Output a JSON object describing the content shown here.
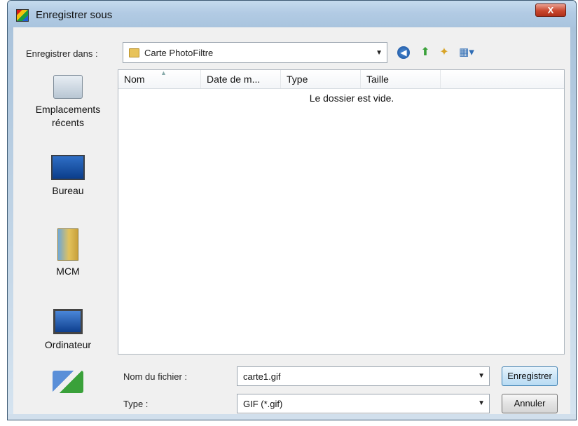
{
  "window": {
    "title": "Enregistrer sous",
    "close_glyph": "X"
  },
  "toolbar": {
    "save_in_label": "Enregistrer dans :",
    "save_in_value": "Carte PhotoFiltre",
    "icons": [
      "back-icon",
      "up-folder-icon",
      "new-folder-icon",
      "views-menu-icon"
    ]
  },
  "places": [
    {
      "label_line1": "Emplacements",
      "label_line2": "récents",
      "icon": "recent-places-icon"
    },
    {
      "label_line1": "Bureau",
      "label_line2": "",
      "icon": "desktop-icon"
    },
    {
      "label_line1": "MCM",
      "label_line2": "",
      "icon": "user-folder-icon"
    },
    {
      "label_line1": "Ordinateur",
      "label_line2": "",
      "icon": "computer-icon"
    },
    {
      "label_line1": "",
      "label_line2": "",
      "icon": "network-icon"
    }
  ],
  "filelist": {
    "columns": [
      "Nom",
      "Date de m...",
      "Type",
      "Taille"
    ],
    "empty_message": "Le dossier est vide."
  },
  "form": {
    "filename_label": "Nom du fichier :",
    "filename_value": "carte1.gif",
    "type_label": "Type :",
    "type_value": "GIF (*.gif)",
    "save_button": "Enregistrer",
    "cancel_button": "Annuler"
  },
  "colors": {
    "titlebar": "#b2cbe4",
    "close_button": "#c9472e",
    "default_button": "#b8dbf3"
  }
}
